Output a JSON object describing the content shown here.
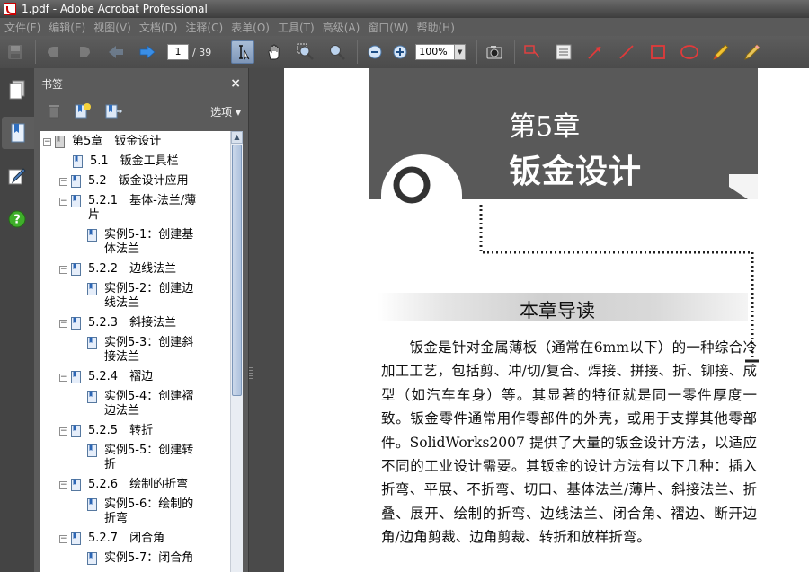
{
  "window": {
    "title": "1.pdf - Adobe Acrobat Professional"
  },
  "menu": [
    "文件(F)",
    "编辑(E)",
    "视图(V)",
    "文档(D)",
    "注释(C)",
    "表单(O)",
    "工具(T)",
    "高级(A)",
    "窗口(W)",
    "帮助(H)"
  ],
  "toolbar": {
    "page_current": "1",
    "page_total": "/ 39",
    "zoom": "100%"
  },
  "panel": {
    "title": "书签",
    "close": "×",
    "options": "选项 ▾",
    "bookmarks": [
      {
        "label": "第5章　钣金设计",
        "level": 0,
        "expander": "⊟"
      },
      {
        "label": "5.1　钣金工具栏",
        "level": 1,
        "expander": ""
      },
      {
        "label": "5.2　钣金设计应用",
        "level": 1,
        "expander": "⊟"
      },
      {
        "label": "5.2.1　基体-法兰/薄\n片",
        "level": 2,
        "expander": "⊟"
      },
      {
        "label": "实例5-1：创建基\n体法兰",
        "level": 3,
        "expander": ""
      },
      {
        "label": "5.2.2　边线法兰",
        "level": 2,
        "expander": "⊟"
      },
      {
        "label": "实例5-2：创建边\n线法兰",
        "level": 3,
        "expander": ""
      },
      {
        "label": "5.2.3　斜接法兰",
        "level": 2,
        "expander": "⊟"
      },
      {
        "label": "实例5-3：创建斜\n接法兰",
        "level": 3,
        "expander": ""
      },
      {
        "label": "5.2.4　褶边",
        "level": 2,
        "expander": "⊟"
      },
      {
        "label": "实例5-4：创建褶\n边法兰",
        "level": 3,
        "expander": ""
      },
      {
        "label": "5.2.5　转折",
        "level": 2,
        "expander": "⊟"
      },
      {
        "label": "实例5-5：创建转\n折",
        "level": 3,
        "expander": ""
      },
      {
        "label": "5.2.6　绘制的折弯",
        "level": 2,
        "expander": "⊟"
      },
      {
        "label": "实例5-6：绘制的\n折弯",
        "level": 3,
        "expander": ""
      },
      {
        "label": "5.2.7　闭合角",
        "level": 2,
        "expander": "⊟"
      },
      {
        "label": "实例5-7：闭合角",
        "level": 3,
        "expander": ""
      }
    ]
  },
  "document": {
    "chapter_number": "第5章",
    "chapter_title": "钣金设计",
    "section_heading": "本章导读",
    "paragraph": "　　钣金是针对金属薄板（通常在6mm以下）的一种综合冷加工工艺，包括剪、冲/切/复合、焊接、拼接、折、铆接、成型（如汽车车身）等。其显著的特征就是同一零件厚度一致。钣金零件通常用作零部件的外壳，或用于支撑其他零部件。SolidWorks2007 提供了大量的钣金设计方法，以适应不同的工业设计需要。其钣金的设计方法有以下几种：插入折弯、平展、不折弯、切口、基体法兰/薄片、斜接法兰、折叠、展开、绘制的折弯、边线法兰、闭合角、褶边、断开边角/边角剪裁、边角剪裁、转折和放样折弯。"
  },
  "colors": {
    "chrome": "#4b4b4b",
    "accent_blue": "#2f7fd8",
    "chapter_block": "#595959"
  }
}
